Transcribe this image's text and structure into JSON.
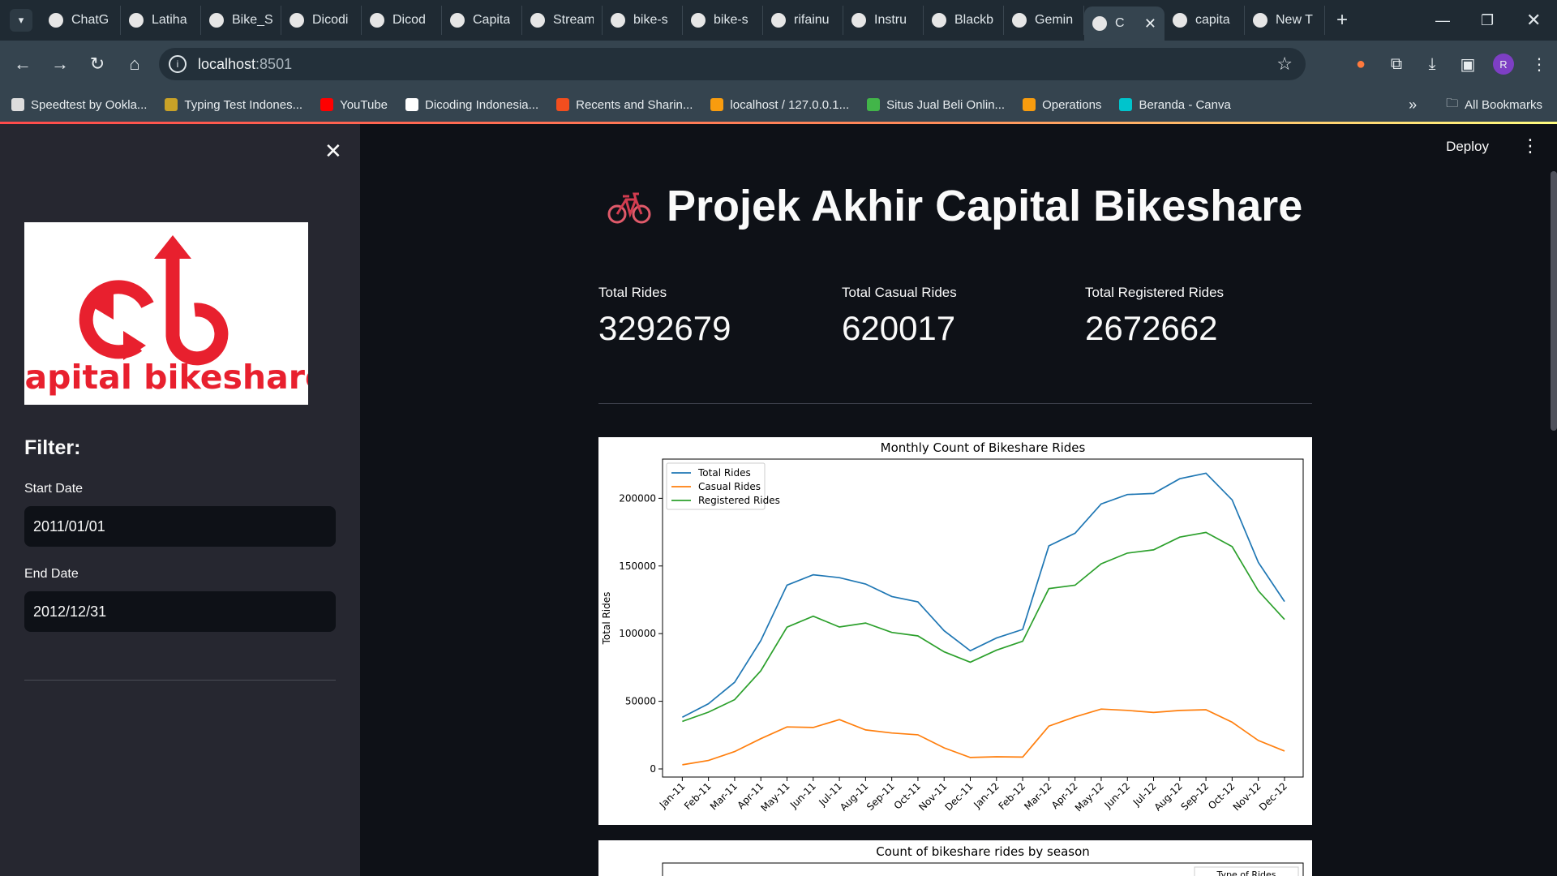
{
  "browser": {
    "tabs": [
      {
        "label": "ChatG",
        "icon": "openai-icon"
      },
      {
        "label": "Latiha",
        "icon": "dicoding-icon"
      },
      {
        "label": "Bike_S",
        "icon": "colab-icon"
      },
      {
        "label": "Dicodi",
        "icon": "github-icon"
      },
      {
        "label": "Dicod",
        "icon": "github-icon"
      },
      {
        "label": "Capita",
        "icon": "sheets-icon"
      },
      {
        "label": "Stream",
        "icon": "streamlit-icon"
      },
      {
        "label": "bike-s",
        "icon": "github-icon"
      },
      {
        "label": "bike-s",
        "icon": "github-icon"
      },
      {
        "label": "rifainu",
        "icon": "github-icon"
      },
      {
        "label": "Instru",
        "icon": "dicoding-icon"
      },
      {
        "label": "Blackb",
        "icon": "blackbox-icon"
      },
      {
        "label": "Gemin",
        "icon": "gemini-icon"
      },
      {
        "label": "C",
        "icon": "streamlit-icon",
        "active": true
      },
      {
        "label": "capita",
        "icon": "google-icon"
      },
      {
        "label": "New T",
        "icon": "chrome-icon"
      }
    ],
    "url_host": "localhost",
    "url_port": ":8501",
    "avatar_letter": "R",
    "bookmarks": [
      {
        "label": "Speedtest by Ookla...",
        "color": "#dddddd"
      },
      {
        "label": "Typing Test Indones...",
        "color": "#c9a227"
      },
      {
        "label": "YouTube",
        "color": "#ff0000"
      },
      {
        "label": "Dicoding Indonesia...",
        "color": "#ffffff"
      },
      {
        "label": "Recents and Sharin...",
        "color": "#f24e1e"
      },
      {
        "label": "localhost / 127.0.0.1...",
        "color": "#f89c0e"
      },
      {
        "label": "Situs Jual Beli Onlin...",
        "color": "#42b549"
      },
      {
        "label": "Operations",
        "color": "#f89c0e"
      },
      {
        "label": "Beranda - Canva",
        "color": "#00c4cc"
      }
    ],
    "all_bookmarks": "All Bookmarks"
  },
  "sidebar": {
    "logo_text": "capital bikeshare",
    "logo_color": "#e8202e",
    "filter_title": "Filter:",
    "start_label": "Start Date",
    "start_value": "2011/01/01",
    "end_label": "End Date",
    "end_value": "2012/12/31"
  },
  "header": {
    "deploy": "Deploy"
  },
  "main": {
    "title": "Projek Akhir Capital Bikeshare",
    "metrics": [
      {
        "label": "Total Rides",
        "value": "3292679"
      },
      {
        "label": "Total Casual Rides",
        "value": "620017"
      },
      {
        "label": "Total Registered Rides",
        "value": "2672662"
      }
    ]
  },
  "chart_data": [
    {
      "type": "line",
      "title": "Monthly Count of Bikeshare Rides",
      "xlabel": "",
      "ylabel": "Total Rides",
      "ylim": [
        -6000,
        229000
      ],
      "yticks": [
        0,
        50000,
        100000,
        150000,
        200000
      ],
      "legend_position": "upper-left",
      "categories": [
        "Jan-11",
        "Feb-11",
        "Mar-11",
        "Apr-11",
        "May-11",
        "Jun-11",
        "Jul-11",
        "Aug-11",
        "Sep-11",
        "Oct-11",
        "Nov-11",
        "Dec-11",
        "Jan-12",
        "Feb-12",
        "Mar-12",
        "Apr-12",
        "May-12",
        "Jun-12",
        "Jul-12",
        "Aug-12",
        "Sep-12",
        "Oct-12",
        "Nov-12",
        "Dec-12"
      ],
      "series": [
        {
          "name": "Total Rides",
          "color": "#1f77b4",
          "values": [
            38189,
            48215,
            64045,
            94870,
            135821,
            143512,
            141341,
            136691,
            127418,
            123511,
            102167,
            87323,
            96744,
            103137,
            164875,
            174224,
            195865,
            202830,
            203607,
            214503,
            218573,
            198841,
            152664,
            123713
          ]
        },
        {
          "name": "Casual Rides",
          "color": "#ff7f0e",
          "values": [
            3073,
            6242,
            12826,
            22346,
            31050,
            30612,
            36452,
            28842,
            26545,
            25222,
            15594,
            8448,
            8969,
            8721,
            31618,
            38456,
            44235,
            43294,
            41705,
            43197,
            43778,
            34538,
            21009,
            13245
          ]
        },
        {
          "name": "Registered Rides",
          "color": "#2ca02c",
          "values": [
            35116,
            41973,
            51219,
            72524,
            104771,
            112900,
            104889,
            107849,
            100873,
            98289,
            86573,
            78875,
            87775,
            94416,
            133257,
            135768,
            151630,
            159536,
            161902,
            171306,
            174795,
            164303,
            131655,
            110468
          ]
        }
      ]
    },
    {
      "type": "bar",
      "title": "Count of bikeshare rides by season",
      "legend_title": "Type of Rides"
    }
  ]
}
